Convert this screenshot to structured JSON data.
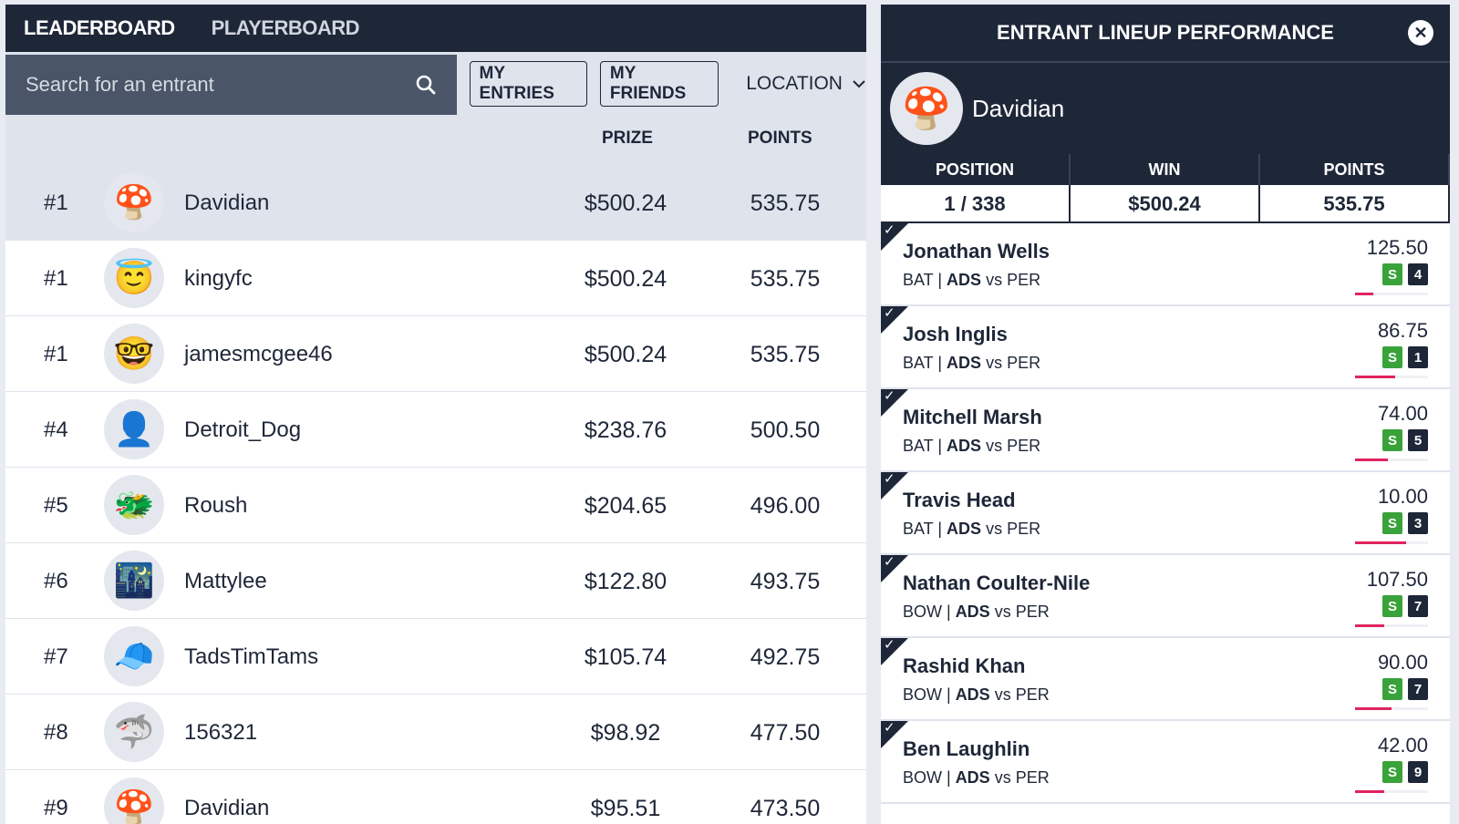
{
  "tabs": [
    {
      "label": "LEADERBOARD",
      "active": true
    },
    {
      "label": "PLAYERBOARD",
      "active": false
    }
  ],
  "search": {
    "placeholder": "Search for an entrant",
    "value": ""
  },
  "filters": {
    "my_entries": "MY ENTRIES",
    "my_friends": "MY FRIENDS",
    "location": "LOCATION"
  },
  "columns": {
    "prize": "PRIZE",
    "points": "POINTS"
  },
  "rows": [
    {
      "rank": "#1",
      "name": "Davidian",
      "prize": "$500.24",
      "points": "535.75",
      "avatar": "mushroom-avatar",
      "highlight": true
    },
    {
      "rank": "#1",
      "name": "kingyfc",
      "prize": "$500.24",
      "points": "535.75",
      "avatar": "angel-emoji-avatar",
      "highlight": false
    },
    {
      "rank": "#1",
      "name": "jamesmcgee46",
      "prize": "$500.24",
      "points": "535.75",
      "avatar": "glasses-face-avatar",
      "highlight": false
    },
    {
      "rank": "#4",
      "name": "Detroit_Dog",
      "prize": "$238.76",
      "points": "500.50",
      "avatar": "photo-avatar",
      "highlight": false
    },
    {
      "rank": "#5",
      "name": "Roush",
      "prize": "$204.65",
      "points": "496.00",
      "avatar": "creature-avatar",
      "highlight": false
    },
    {
      "rank": "#6",
      "name": "Mattylee",
      "prize": "$122.80",
      "points": "493.75",
      "avatar": "night-photo-avatar",
      "highlight": false
    },
    {
      "rank": "#7",
      "name": "TadsTimTams",
      "prize": "$105.74",
      "points": "492.75",
      "avatar": "cap-avatar",
      "highlight": false
    },
    {
      "rank": "#8",
      "name": "156321",
      "prize": "$98.92",
      "points": "477.50",
      "avatar": "shark-avatar",
      "highlight": false
    },
    {
      "rank": "#9",
      "name": "Davidian",
      "prize": "$95.51",
      "points": "473.50",
      "avatar": "mushroom-avatar",
      "highlight": false
    }
  ],
  "panel": {
    "title": "ENTRANT LINEUP PERFORMANCE",
    "user": "Davidian",
    "stats": {
      "position_label": "POSITION",
      "position": "1 / 338",
      "win_label": "WIN",
      "win": "$500.24",
      "points_label": "POINTS",
      "points": "535.75"
    },
    "players": [
      {
        "name": "Jonathan Wells",
        "role": "BAT",
        "team": "ADS",
        "vs": "vs",
        "opp": "PER",
        "points": "125.50",
        "badge": "S",
        "num": "4",
        "progress": 0.25
      },
      {
        "name": "Josh Inglis",
        "role": "BAT",
        "team": "ADS",
        "vs": "vs",
        "opp": "PER",
        "points": "86.75",
        "badge": "S",
        "num": "1",
        "progress": 0.55
      },
      {
        "name": "Mitchell Marsh",
        "role": "BAT",
        "team": "ADS",
        "vs": "vs",
        "opp": "PER",
        "points": "74.00",
        "badge": "S",
        "num": "5",
        "progress": 0.45
      },
      {
        "name": "Travis Head",
        "role": "BAT",
        "team": "ADS",
        "vs": "vs",
        "opp": "PER",
        "points": "10.00",
        "badge": "S",
        "num": "3",
        "progress": 0.7
      },
      {
        "name": "Nathan Coulter-Nile",
        "role": "BOW",
        "team": "ADS",
        "vs": "vs",
        "opp": "PER",
        "points": "107.50",
        "badge": "S",
        "num": "7",
        "progress": 0.4
      },
      {
        "name": "Rashid Khan",
        "role": "BOW",
        "team": "ADS",
        "vs": "vs",
        "opp": "PER",
        "points": "90.00",
        "badge": "S",
        "num": "7",
        "progress": 0.5
      },
      {
        "name": "Ben Laughlin",
        "role": "BOW",
        "team": "ADS",
        "vs": "vs",
        "opp": "PER",
        "points": "42.00",
        "badge": "S",
        "num": "9",
        "progress": 0.4
      }
    ]
  },
  "colors": {
    "navy": "#1e2738",
    "grey": "#dfe3ec",
    "green": "#3aa23a",
    "pink": "#e0245e"
  }
}
